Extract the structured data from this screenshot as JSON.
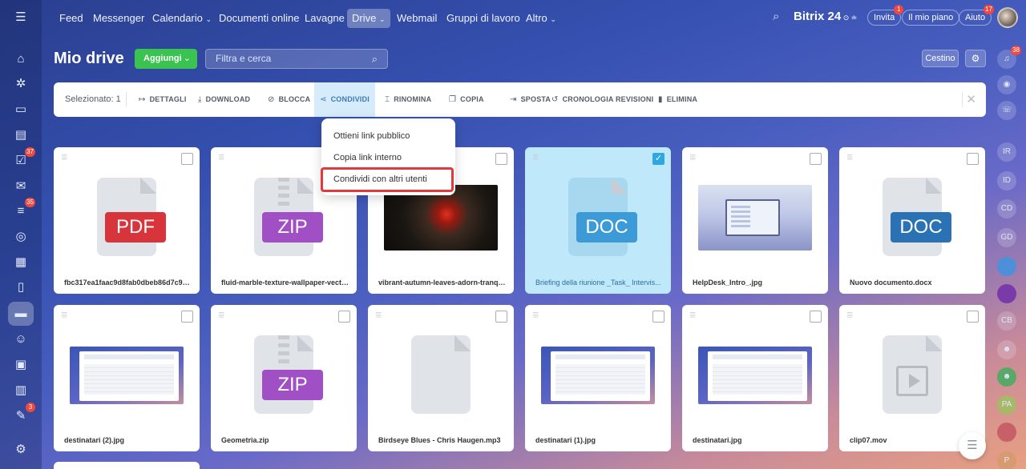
{
  "colors": {
    "accent_green": "#3bc351",
    "pdf_red": "#d8343c",
    "zip_purple": "#a14fc4",
    "doc_blue_light": "#3c9ad6",
    "doc_blue": "#2b72b5",
    "selected_bg": "#bfe8fb",
    "highlight_red": "#e0393e"
  },
  "left_rail": {
    "badges": {
      "tasks": "37",
      "feed": "35",
      "approvals": "3"
    }
  },
  "topnav": {
    "items": [
      "Feed",
      "Messenger",
      "Calendario",
      "Documenti online",
      "Lavagne",
      "Drive",
      "Webmail",
      "Gruppi di lavoro",
      "Altro"
    ],
    "active_index": 5,
    "brand": "Bitrix",
    "brand_num": "24",
    "invite_label": "Invita",
    "invite_badge": "1",
    "myplan_label": "Il mio piano",
    "help_label": "Aiuto",
    "help_badge": "17"
  },
  "right_rail": {
    "notif_badge": "38",
    "users": [
      "IR",
      "ID",
      "CD",
      "GD",
      "",
      "",
      "CB",
      "",
      "",
      "PA",
      "",
      "P"
    ]
  },
  "page": {
    "title": "Mio drive",
    "add_label": "Aggiungi",
    "filter_placeholder": "Filtra e cerca",
    "trash_label": "Cestino"
  },
  "toolbar": {
    "selected_label": "Selezionato: 1",
    "actions": [
      "DETTAGLI",
      "DOWNLOAD",
      "BLOCCA",
      "CONDIVIDI",
      "RINOMINA",
      "COPIA",
      "SPOSTA",
      "CRONOLOGIA REVISIONI",
      "ELIMINA"
    ],
    "active_action": "CONDIVIDI"
  },
  "share_menu": {
    "items": [
      "Ottieni link pubblico",
      "Copia link interno",
      "Condividi con altri utenti"
    ],
    "highlighted_index": 2
  },
  "files": [
    {
      "name": "fbc317ea1faac9d8fab0dbeb86d7c9c3...",
      "kind": "PDF",
      "selected": false
    },
    {
      "name": "fluid-marble-texture-wallpaper-vecto...",
      "kind": "ZIP",
      "selected": false
    },
    {
      "name": "vibrant-autumn-leaves-adorn-tranqu...",
      "kind": "photo-autumn",
      "selected": false
    },
    {
      "name": "Briefing della riunione _Task_ Intervis...",
      "kind": "DOC",
      "selected": true
    },
    {
      "name": "HelpDesk_Intro_.jpg",
      "kind": "photo-helpdesk",
      "selected": false
    },
    {
      "name": "Nuovo documento.docx",
      "kind": "DOC",
      "selected": false
    },
    {
      "name": "destinatari (2).jpg",
      "kind": "screenshot",
      "selected": false
    },
    {
      "name": "Geometria.zip",
      "kind": "ZIP",
      "selected": false
    },
    {
      "name": "Birdseye Blues - Chris Haugen.mp3",
      "kind": "generic",
      "selected": false
    },
    {
      "name": "destinatari (1).jpg",
      "kind": "screenshot",
      "selected": false
    },
    {
      "name": "destinatari.jpg",
      "kind": "screenshot",
      "selected": false
    },
    {
      "name": "clip07.mov",
      "kind": "video",
      "selected": false
    }
  ]
}
